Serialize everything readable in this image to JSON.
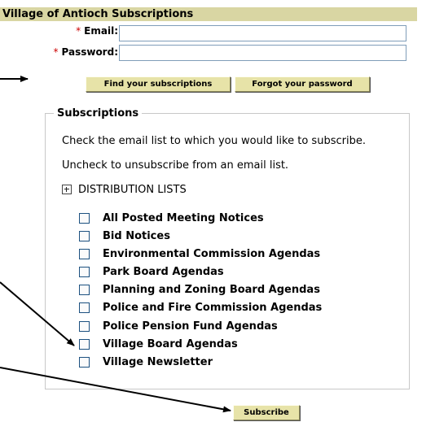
{
  "header": {
    "title": "Village of Antioch Subscriptions"
  },
  "form": {
    "required_marker": "*",
    "email_label": "Email:",
    "email_value": "",
    "password_label": "Password:",
    "password_value": ""
  },
  "buttons": {
    "find": "Find your subscriptions",
    "forgot": "Forgot your password",
    "subscribe": "Subscribe"
  },
  "subscriptions": {
    "legend": "Subscriptions",
    "instruction_check": "Check the email list to which you would like to subscribe.",
    "instruction_uncheck": "Uncheck to unsubscribe from an email list.",
    "group_label": "DISTRIBUTION LISTS",
    "items": [
      {
        "label": "All Posted Meeting Notices",
        "checked": false
      },
      {
        "label": "Bid Notices",
        "checked": false
      },
      {
        "label": "Environmental Commission Agendas",
        "checked": false
      },
      {
        "label": "Park Board Agendas",
        "checked": false
      },
      {
        "label": "Planning and Zoning Board Agendas",
        "checked": false
      },
      {
        "label": "Police and Fire Commission Agendas",
        "checked": false
      },
      {
        "label": "Police Pension Fund Agendas",
        "checked": false
      },
      {
        "label": "Village Board Agendas",
        "checked": false
      },
      {
        "label": "Village Newsletter",
        "checked": false
      }
    ]
  },
  "colors": {
    "header_bg": "#d9d6a3",
    "button_bg": "#e7e3a8",
    "required": "#cc0000"
  }
}
